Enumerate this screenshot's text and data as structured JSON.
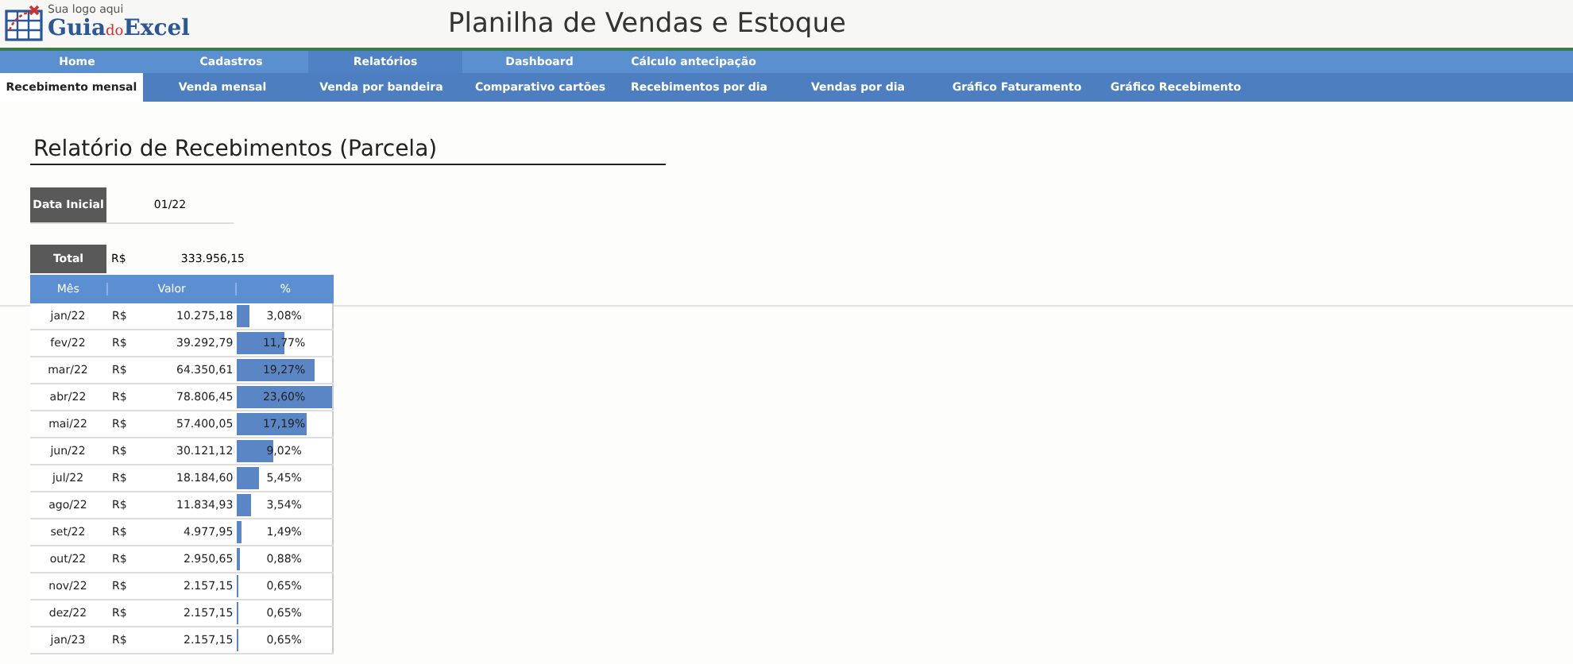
{
  "logo": {
    "caption": "Sua logo aqui",
    "parts": [
      "Guia",
      "do",
      "Excel"
    ]
  },
  "title": "Planilha de Vendas e Estoque",
  "menu": [
    {
      "label": "Home",
      "selected": false
    },
    {
      "label": "Cadastros",
      "selected": false
    },
    {
      "label": "Relatórios",
      "selected": true
    },
    {
      "label": "Dashboard",
      "selected": false
    },
    {
      "label": "Cálculo antecipação",
      "selected": false
    }
  ],
  "tabs": [
    {
      "label": "Recebimento mensal",
      "selected": true
    },
    {
      "label": "Venda mensal",
      "selected": false
    },
    {
      "label": "Venda por bandeira",
      "selected": false
    },
    {
      "label": "Comparativo cartões",
      "selected": false
    },
    {
      "label": "Recebimentos por dia",
      "selected": false
    },
    {
      "label": "Vendas por dia",
      "selected": false
    },
    {
      "label": "Gráfico Faturamento",
      "selected": false
    },
    {
      "label": "Gráfico Recebimento",
      "selected": false
    }
  ],
  "report_title": "Relatório de Recebimentos (Parcela)",
  "start_date": {
    "label": "Data Inicial",
    "value": "01/22"
  },
  "total": {
    "label": "Total",
    "currency": "R$",
    "value": "333.956,15"
  },
  "table": {
    "columns": [
      "Mês",
      "Valor",
      "%"
    ],
    "rows": [
      {
        "month": "jan/22",
        "currency": "R$",
        "value": "10.275,18",
        "percent": "3,08%",
        "level": 0.13
      },
      {
        "month": "fev/22",
        "currency": "R$",
        "value": "39.292,79",
        "percent": "11,77%",
        "level": 0.5
      },
      {
        "month": "mar/22",
        "currency": "R$",
        "value": "64.350,61",
        "percent": "19,27%",
        "level": 0.82
      },
      {
        "month": "abr/22",
        "currency": "R$",
        "value": "78.806,45",
        "percent": "23,60%",
        "level": 1
      },
      {
        "month": "mai/22",
        "currency": "R$",
        "value": "57.400,05",
        "percent": "17,19%",
        "level": 0.73
      },
      {
        "month": "jun/22",
        "currency": "R$",
        "value": "30.121,12",
        "percent": "9,02%",
        "level": 0.38
      },
      {
        "month": "jul/22",
        "currency": "R$",
        "value": "18.184,60",
        "percent": "5,45%",
        "level": 0.23
      },
      {
        "month": "ago/22",
        "currency": "R$",
        "value": "11.834,93",
        "percent": "3,54%",
        "level": 0.15
      },
      {
        "month": "set/22",
        "currency": "R$",
        "value": "4.977,95",
        "percent": "1,49%",
        "level": 0.06
      },
      {
        "month": "out/22",
        "currency": "R$",
        "value": "2.950,65",
        "percent": "0,88%",
        "level": 0.04
      },
      {
        "month": "nov/22",
        "currency": "R$",
        "value": "2.157,15",
        "percent": "0,65%",
        "level": 0.03
      },
      {
        "month": "dez/22",
        "currency": "R$",
        "value": "2.157,15",
        "percent": "0,65%",
        "level": 0.03
      },
      {
        "month": "jan/23",
        "currency": "R$",
        "value": "2.157,15",
        "percent": "0,65%",
        "level": 0.03
      }
    ]
  }
}
